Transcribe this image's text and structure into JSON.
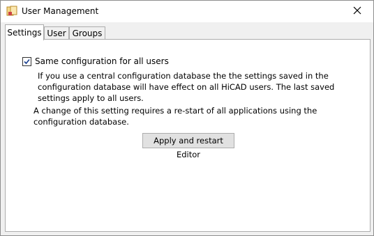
{
  "window": {
    "title": "User Management"
  },
  "tabs": [
    {
      "label": "Settings"
    },
    {
      "label": "User"
    },
    {
      "label": "Groups"
    }
  ],
  "settings": {
    "checkbox_label": "Same configuration for all users",
    "checkbox_checked": true,
    "description": "If you use a central configuration database the the settings saved in the configuration database will have effect on all HiCAD users. The last saved settings apply to all users.",
    "restart_note": "A change of this setting requires a re-start of all applications using the configuration database.",
    "apply_button": "Apply and restart Editor"
  },
  "icons": {
    "app": "app-icon",
    "close": "close-icon",
    "check": "checkmark-icon"
  }
}
